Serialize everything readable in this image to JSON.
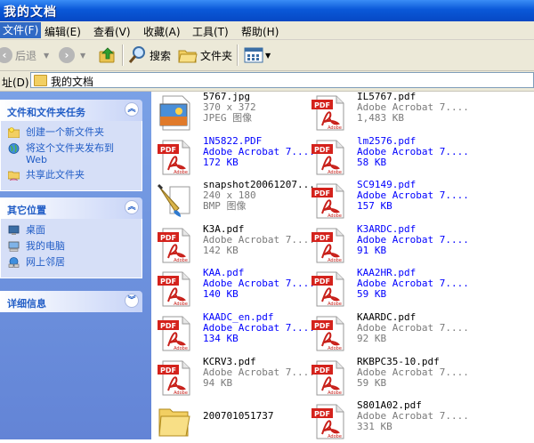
{
  "window": {
    "title": "我的文档"
  },
  "menu": [
    {
      "label": "文件(F)",
      "active": true
    },
    {
      "label": "编辑(E)"
    },
    {
      "label": "查看(V)"
    },
    {
      "label": "收藏(A)"
    },
    {
      "label": "工具(T)"
    },
    {
      "label": "帮助(H)"
    }
  ],
  "toolbar": {
    "back": "后退",
    "search": "搜索",
    "folders": "文件夹"
  },
  "address": {
    "label": "址(D)",
    "value": "我的文档"
  },
  "tasks": {
    "title": "文件和文件夹任务",
    "items": [
      {
        "label": "创建一个新文件夹"
      },
      {
        "label": "将这个文件夹发布到",
        "sub": "Web"
      },
      {
        "label": "共享此文件夹"
      }
    ]
  },
  "places": {
    "title": "其它位置",
    "items": [
      {
        "label": "桌面"
      },
      {
        "label": "我的电脑"
      },
      {
        "label": "网上邻居"
      }
    ]
  },
  "details": {
    "title": "详细信息"
  },
  "files": [
    {
      "name": "5767.jpg",
      "l2": "370 x 372",
      "l3": "JPEG 图像",
      "kind": "jpg",
      "blue": false
    },
    {
      "name": "IL5767.pdf",
      "l2": "Adobe Acrobat 7....",
      "l3": "1,483 KB",
      "kind": "pdf",
      "blue": false
    },
    {
      "name": "1N5822.PDF",
      "l2": "Adobe Acrobat 7....",
      "l3": "172 KB",
      "kind": "pdf",
      "blue": true
    },
    {
      "name": "lm2576.pdf",
      "l2": "Adobe Acrobat 7....",
      "l3": "58 KB",
      "kind": "pdf",
      "blue": true
    },
    {
      "name": "snapshot20061207...",
      "l2": "240 x 180",
      "l3": "BMP 图像",
      "kind": "bmp",
      "blue": false
    },
    {
      "name": "SC9149.pdf",
      "l2": "Adobe Acrobat 7....",
      "l3": "157 KB",
      "kind": "pdf",
      "blue": true
    },
    {
      "name": "K3A.pdf",
      "l2": "Adobe Acrobat 7....",
      "l3": "142 KB",
      "kind": "pdf",
      "blue": false
    },
    {
      "name": "K3ARDC.pdf",
      "l2": "Adobe Acrobat 7....",
      "l3": "91 KB",
      "kind": "pdf",
      "blue": true
    },
    {
      "name": "KAA.pdf",
      "l2": "Adobe Acrobat 7....",
      "l3": "140 KB",
      "kind": "pdf",
      "blue": true
    },
    {
      "name": "KAA2HR.pdf",
      "l2": "Adobe Acrobat 7....",
      "l3": "59 KB",
      "kind": "pdf",
      "blue": true
    },
    {
      "name": "KAADC_en.pdf",
      "l2": "Adobe Acrobat 7....",
      "l3": "134 KB",
      "kind": "pdf",
      "blue": true
    },
    {
      "name": "KAARDC.pdf",
      "l2": "Adobe Acrobat 7....",
      "l3": "92 KB",
      "kind": "pdf",
      "blue": false
    },
    {
      "name": "KCRV3.pdf",
      "l2": "Adobe Acrobat 7....",
      "l3": "94 KB",
      "kind": "pdf",
      "blue": false
    },
    {
      "name": "RKBPC35-10.pdf",
      "l2": "Adobe Acrobat 7....",
      "l3": "59 KB",
      "kind": "pdf",
      "blue": false
    },
    {
      "name": "200701051737",
      "l2": "",
      "l3": "",
      "kind": "folder",
      "blue": false
    },
    {
      "name": "S801A02.pdf",
      "l2": "Adobe Acrobat 7....",
      "l3": "331 KB",
      "kind": "pdf",
      "blue": false
    }
  ],
  "icons": {
    "pdf_badge": "PDF",
    "pdf_brand": "Adobe"
  },
  "colors": {
    "titlebar": "#0a58d8",
    "link": "#215dc6",
    "highlight": "#0000ff"
  }
}
